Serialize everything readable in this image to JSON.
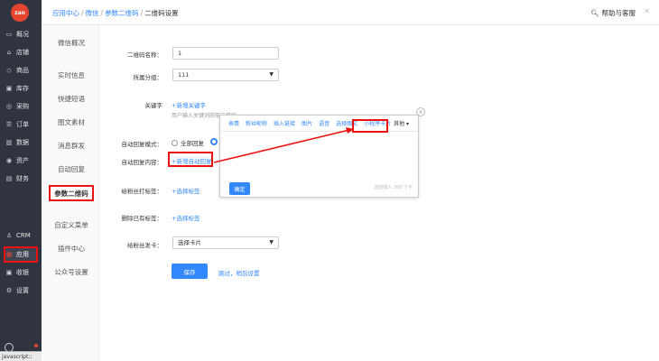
{
  "logo": "zan",
  "nav": {
    "items": [
      {
        "icon": "monitor-icon",
        "label": "概况"
      },
      {
        "icon": "store-icon",
        "label": "店铺"
      },
      {
        "icon": "tag-icon",
        "label": "商品"
      },
      {
        "icon": "box-icon",
        "label": "库存"
      },
      {
        "icon": "cart-icon",
        "label": "采购"
      },
      {
        "icon": "list-icon",
        "label": "订单"
      },
      {
        "icon": "chart-icon",
        "label": "数据"
      },
      {
        "icon": "money-icon",
        "label": "资产"
      },
      {
        "icon": "doc-icon",
        "label": "财务"
      },
      {
        "icon": "user-icon",
        "label": "CRM"
      },
      {
        "icon": "grid-icon",
        "label": "应用"
      },
      {
        "icon": "inbox-icon",
        "label": "收银"
      },
      {
        "icon": "gear-icon",
        "label": "设置"
      }
    ]
  },
  "status_text": "javascript:;",
  "breadcrumb": {
    "items": [
      "应用中心",
      "微信",
      "参数二维码"
    ],
    "current": "二维码设置",
    "separator": "/"
  },
  "help": {
    "label": "帮助与客服"
  },
  "subnav": {
    "items": [
      "微信概况",
      "实时信息",
      "快捷短语",
      "图文素材",
      "消息群发",
      "自动回复",
      "参数二维码",
      "自定义菜单",
      "插件中心",
      "公众号设置"
    ]
  },
  "form": {
    "name_label": "二维码名称：",
    "name_value": "1",
    "group_label": "所属分组：",
    "group_value": "111",
    "keyword_label": "关键字",
    "keyword_link": "+新增关键字",
    "keyword_hint": "用户输入关键词获取二维码",
    "mode_label": "自动回复模式：",
    "mode_option_1": "全部回复",
    "content_label": "自动回复内容：",
    "content_link": "+新增自动回复",
    "tag_label": "给粉丝打标签：",
    "tag_link": "+选择标签",
    "remove_tag_label": "删除已有标签：",
    "remove_tag_link": "+选择标签",
    "card_label": "给粉丝发卡：",
    "card_value": "选择卡片",
    "save_label": "保存",
    "skip_label": "跳过，稍后设置"
  },
  "popup": {
    "tools": [
      "表情",
      "粉丝昵称",
      "插入链接",
      "图片",
      "语音",
      "选择图文",
      "小程序卡片"
    ],
    "more": "其他",
    "confirm": "确定",
    "count": "还能输入 300 个字"
  },
  "colors": {
    "accent": "#3388ff",
    "nav_bg": "#2f3440",
    "highlight": "#ee1111",
    "logo": "#e5442f"
  }
}
